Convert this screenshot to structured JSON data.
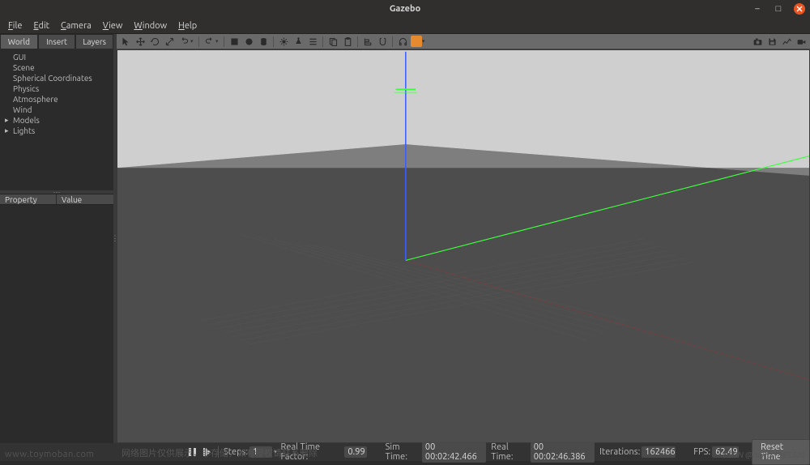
{
  "window": {
    "title": "Gazebo"
  },
  "menu": {
    "items": [
      "File",
      "Edit",
      "Camera",
      "View",
      "Window",
      "Help"
    ]
  },
  "tabs": {
    "items": [
      "World",
      "Insert",
      "Layers"
    ],
    "active_index": 0
  },
  "tree": {
    "items": [
      {
        "label": "GUI",
        "expandable": false
      },
      {
        "label": "Scene",
        "expandable": false
      },
      {
        "label": "Spherical Coordinates",
        "expandable": false
      },
      {
        "label": "Physics",
        "expandable": false
      },
      {
        "label": "Atmosphere",
        "expandable": false
      },
      {
        "label": "Wind",
        "expandable": false
      },
      {
        "label": "Models",
        "expandable": true
      },
      {
        "label": "Lights",
        "expandable": true
      }
    ]
  },
  "prop": {
    "h_property": "Property",
    "h_value": "Value"
  },
  "toolbar": {
    "icons": [
      "pointer",
      "move",
      "rotate",
      "scale",
      "undo",
      "dd",
      "sep",
      "redo",
      "dd",
      "sep",
      "box",
      "sphere",
      "cylinder",
      "sep",
      "pointlight",
      "spotlight",
      "directional",
      "sep",
      "copy",
      "paste",
      "sep",
      "align",
      "snap",
      "sep",
      "headphones",
      "orange",
      "dd"
    ],
    "right_icons": [
      "camera",
      "save",
      "plot",
      "video"
    ]
  },
  "status": {
    "steps_label": "Steps:",
    "steps_val": "1",
    "rtf_label": "Real Time Factor:",
    "rtf_val": "0.99",
    "simtime_label": "Sim Time:",
    "simtime_val": "00 00:02:42.466",
    "realtime_label": "Real Time:",
    "realtime_val": "00 00:02:46.386",
    "iter_label": "Iterations:",
    "iter_val": "162466",
    "fps_label": "FPS:",
    "fps_val": "62.49",
    "reset": "Reset Time"
  },
  "watermark": {
    "left": "www.toymoban.com",
    "left2": "网络图片仅供展示，非存储，如有侵权请联系删除",
    "right": "CSDN @m0_51985300"
  }
}
